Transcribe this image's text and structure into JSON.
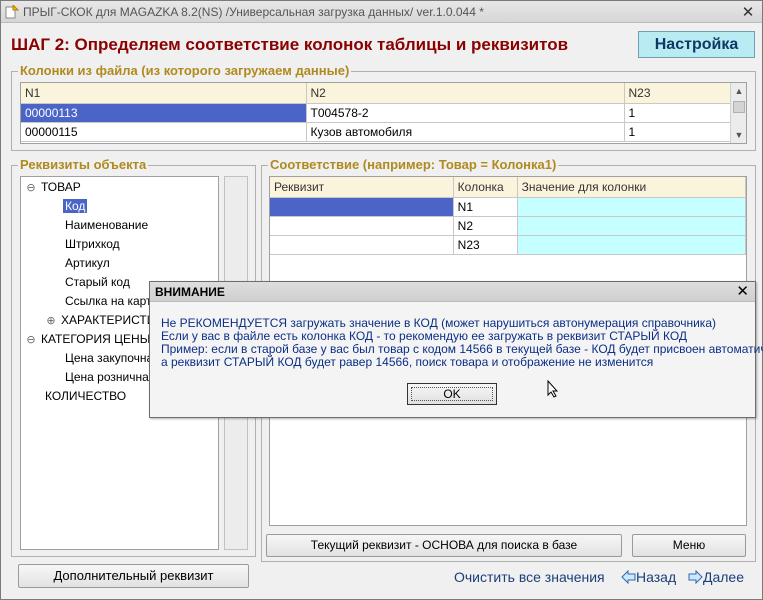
{
  "window": {
    "title": "ПРЫГ-СКОК для MAGAZKA 8.2(NS)  /Универсальная загрузка данных/ ver.1.0.044 *",
    "close": "✕"
  },
  "step_title": "ШАГ 2: Определяем соответствие колонок таблицы и реквизитов",
  "settings_button": "Настройка",
  "file_columns": {
    "label": "Колонки из файла (из которого загружаем данные)",
    "headers": [
      "N1",
      "N2",
      "N23"
    ],
    "rows": [
      [
        "00000113",
        "T004578-2",
        "1"
      ],
      [
        "00000115",
        "Кузов автомобиля",
        "1"
      ]
    ]
  },
  "props": {
    "label": "Реквизиты объекта",
    "tree": [
      {
        "text": "ТОВАР",
        "exp": "⊖"
      },
      {
        "text": "Код"
      },
      {
        "text": "Наименование"
      },
      {
        "text": "Штрихкод"
      },
      {
        "text": "Артикул"
      },
      {
        "text": "Старый код"
      },
      {
        "text": "Ссылка на карти"
      },
      {
        "text": "ХАРАКТЕРИСТИ",
        "exp": "⊕"
      },
      {
        "text": "КАТЕГОРИЯ ЦЕНЫ",
        "exp": "⊖"
      },
      {
        "text": "Цена закупочная"
      },
      {
        "text": "Цена розничная"
      },
      {
        "text": "КОЛИЧЕСТВО"
      }
    ],
    "add_button": "Дополнительный реквизит"
  },
  "mapping": {
    "label": "Соответствие (например: Товар = Колонка1)",
    "headers": [
      "Реквизит",
      "Колонка",
      "Значение для колонки"
    ],
    "rows": [
      [
        "",
        "N1",
        ""
      ],
      [
        "",
        "N2",
        ""
      ],
      [
        "",
        "N23",
        ""
      ]
    ],
    "base_button": "Текущий реквизит - ОСНОВА для поиска в базе",
    "menu_button": "Меню"
  },
  "footer": {
    "clear": "Очистить все значения",
    "back": "Назад",
    "next": "Далее"
  },
  "dialog": {
    "title": "ВНИМАНИЕ",
    "close": "✕",
    "lines": [
      "Не РЕКОМЕНДУЕТСЯ загружать значение в КОД (может нарушиться автонумерация справочника)",
      "Если у вас в файле есть колонка КОД - то рекомендую ее загружать в реквизит СТАРЫЙ КОД",
      "Пример: если в старой базе у вас был товар с кодом 14566 в текущей базе - КОД будет присвоен автоматически",
      "а реквизит СТАРЫЙ КОД будет равер 14566, поиск товара и отображение не изменится"
    ],
    "ok": "OK"
  },
  "colors": {
    "step_title": "#8b0000",
    "group_label": "#b08a1e",
    "selection": "#4a64c8",
    "cyan_cell": "#c6ffff",
    "settings_bg": "#b8ecf2"
  }
}
